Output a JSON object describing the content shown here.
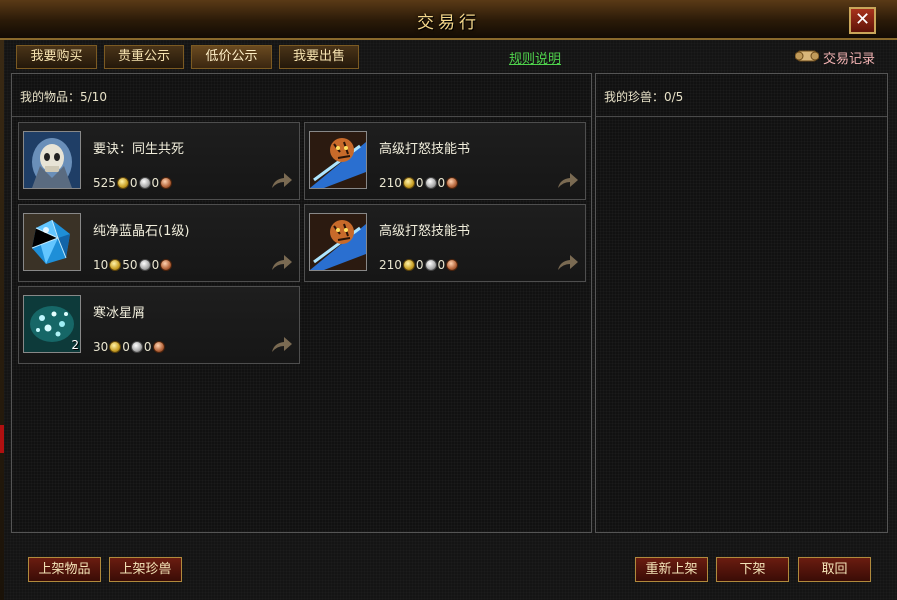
{
  "window": {
    "title": "交易行",
    "close_label": "✕"
  },
  "tabs": [
    {
      "label": "我要购买",
      "active": false
    },
    {
      "label": "贵重公示",
      "active": false
    },
    {
      "label": "低价公示",
      "active": true
    },
    {
      "label": "我要出售",
      "active": false
    }
  ],
  "rules_link": "规则说明",
  "trade_record": {
    "label": "交易记录",
    "icon": "scroll-icon"
  },
  "items_panel": {
    "label": "我的物品：5/10",
    "items": [
      {
        "name": "要诀：同生共死",
        "icon": "skull-ghost-icon",
        "gold": "525",
        "silver": "0",
        "copper": "0",
        "qty": ""
      },
      {
        "name": "高级打怒技能书",
        "icon": "tiger-book-icon",
        "gold": "210",
        "silver": "0",
        "copper": "0",
        "qty": ""
      },
      {
        "name": "纯净蓝晶石(1级)",
        "icon": "blue-crystal-icon",
        "gold": "10",
        "silver": "50",
        "copper": "0",
        "qty": ""
      },
      {
        "name": "高级打怒技能书",
        "icon": "tiger-book-icon",
        "gold": "210",
        "silver": "0",
        "copper": "0",
        "qty": ""
      },
      {
        "name": "寒冰星屑",
        "icon": "ice-stardust-icon",
        "gold": "30",
        "silver": "0",
        "copper": "0",
        "qty": "2"
      }
    ]
  },
  "pets_panel": {
    "label": "我的珍兽：0/5"
  },
  "buttons": {
    "list_item": "上架物品",
    "list_pet": "上架珍兽",
    "relist": "重新上架",
    "delist": "下架",
    "cancel": "取回"
  },
  "colors": {
    "gold_text": "#f3d68a",
    "link_green": "#4fd24c",
    "record_pink": "#f1b2b2",
    "button_red": "#6a1c10"
  }
}
